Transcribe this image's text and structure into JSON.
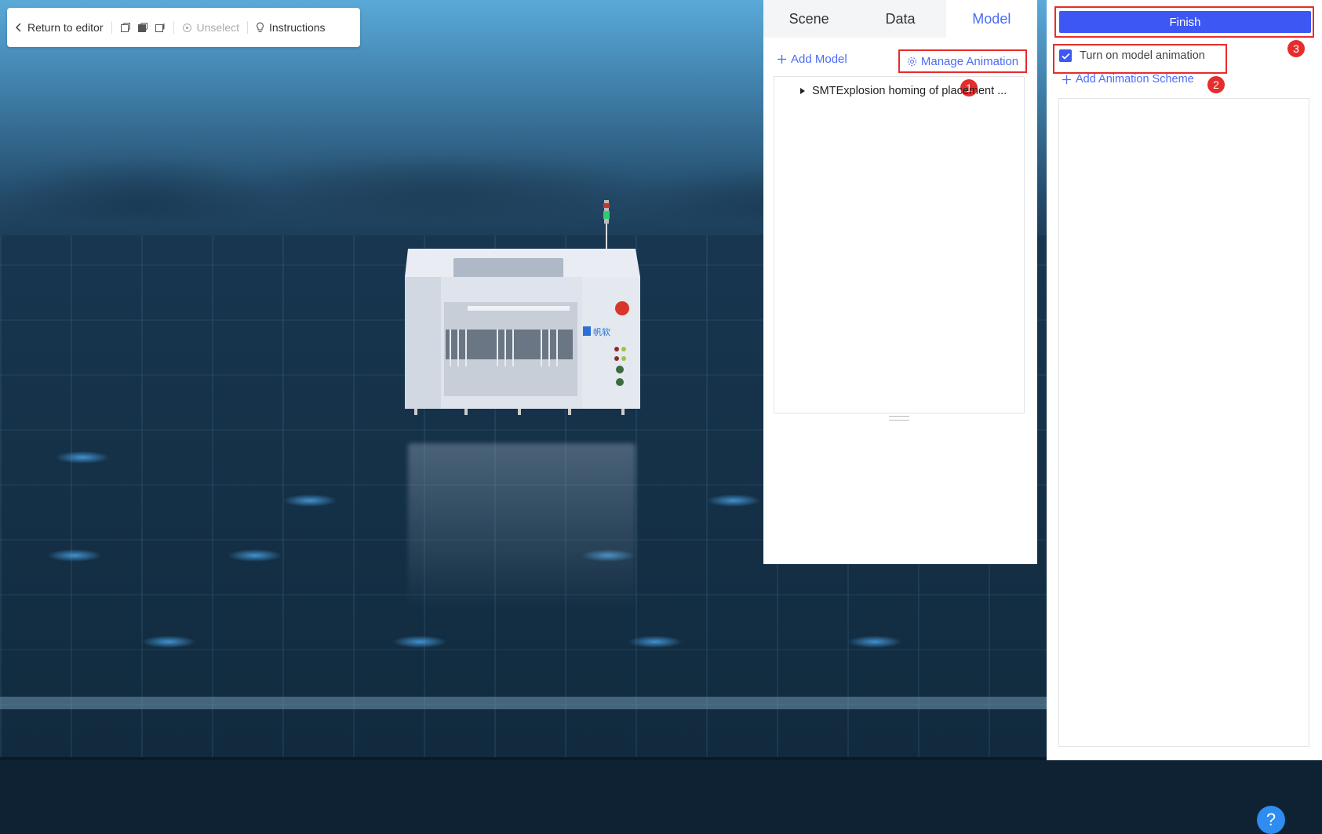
{
  "toolbar": {
    "return_label": "Return to editor",
    "unselect_label": "Unselect",
    "instructions_label": "Instructions"
  },
  "tabs": [
    {
      "label": "Scene"
    },
    {
      "label": "Data"
    },
    {
      "label": "Model"
    }
  ],
  "model_panel": {
    "add_model_label": "Add Model",
    "manage_animation_label": "Manage Animation",
    "tree_item": "SMTExplosion homing of placement ..."
  },
  "animation_panel": {
    "finish_label": "Finish",
    "toggle_label": "Turn on model animation",
    "toggle_checked": true,
    "add_scheme_label": "Add Animation Scheme",
    "help_symbol": "?"
  },
  "machine": {
    "logo_text": "帆软"
  },
  "badges": [
    "1",
    "2",
    "3"
  ],
  "colors": {
    "accent": "#3d57f5",
    "link": "#4a6cf7",
    "highlight": "#e52d2d",
    "help": "#2f8cf0"
  }
}
